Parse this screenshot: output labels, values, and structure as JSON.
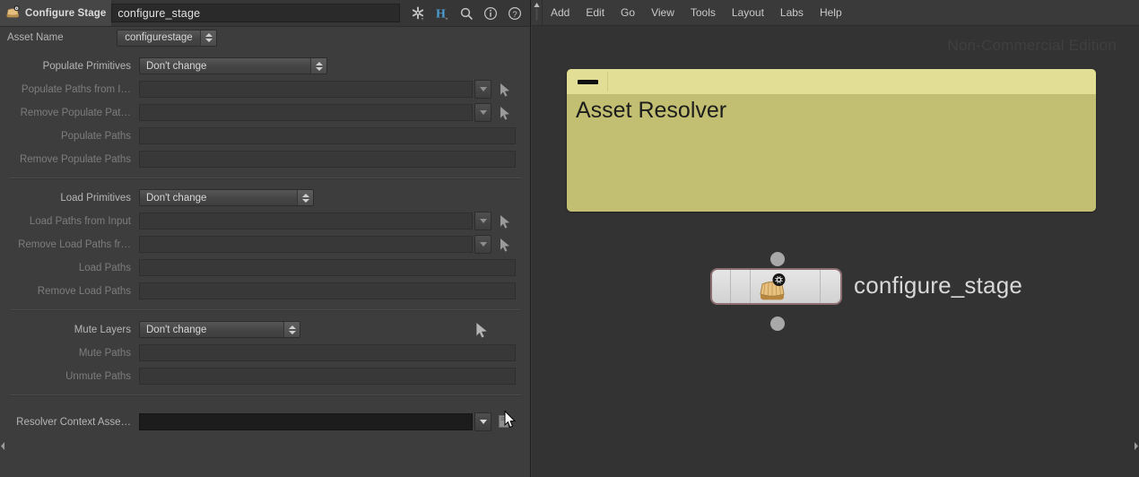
{
  "window": {
    "title": "Configure Stage"
  },
  "param_pane": {
    "tab": {
      "icon": "configure-stage-node-icon",
      "title": "Configure Stage"
    },
    "node_path": "configure_stage",
    "header_icons": [
      {
        "name": "gear-icon",
        "label": "Gear"
      },
      {
        "name": "houdini-h-icon",
        "label": "H"
      },
      {
        "name": "search-icon",
        "label": "Search"
      },
      {
        "name": "info-icon",
        "label": "Info"
      },
      {
        "name": "help-icon",
        "label": "Help"
      }
    ],
    "asset_name": {
      "label": "Asset Name",
      "value": "configurestage"
    },
    "groups": [
      {
        "rows": [
          {
            "label": "Populate Primitives",
            "type": "menu",
            "value": "Don't change",
            "disabled": false,
            "menu_width": "w210"
          },
          {
            "label": "Populate Paths from I…",
            "type": "field-drop-link",
            "value": "",
            "disabled": true
          },
          {
            "label": "Remove Populate Pat…",
            "type": "field-drop-link",
            "value": "",
            "disabled": true
          },
          {
            "label": "Populate Paths",
            "type": "field",
            "value": "",
            "disabled": true
          },
          {
            "label": "Remove Populate Paths",
            "type": "field",
            "value": "",
            "disabled": true
          }
        ]
      },
      {
        "rows": [
          {
            "label": "Load Primitives",
            "type": "menu",
            "value": "Don't change",
            "disabled": false,
            "menu_width": "w195"
          },
          {
            "label": "Load Paths from Input",
            "type": "field-drop-link",
            "value": "",
            "disabled": true
          },
          {
            "label": "Remove Load Paths fr…",
            "type": "field-drop-link",
            "value": "",
            "disabled": true
          },
          {
            "label": "Load Paths",
            "type": "field",
            "value": "",
            "disabled": true
          },
          {
            "label": "Remove Load Paths",
            "type": "field",
            "value": "",
            "disabled": true
          }
        ]
      },
      {
        "rows": [
          {
            "label": "Mute Layers",
            "type": "menu-link",
            "value": "Don't change",
            "disabled": false,
            "menu_width": "pmenu"
          },
          {
            "label": "Mute Paths",
            "type": "field",
            "value": "",
            "disabled": true
          },
          {
            "label": "Unmute Paths",
            "type": "field",
            "value": "",
            "disabled": true
          }
        ]
      },
      {
        "rows": [
          {
            "label": "Resolver Context Asse…",
            "type": "field-black-drop-file",
            "value": "",
            "disabled": false
          }
        ]
      }
    ]
  },
  "network_editor": {
    "menu": [
      "Add",
      "Edit",
      "Go",
      "View",
      "Tools",
      "Layout",
      "Labs",
      "Help"
    ],
    "watermark": "Non-Commercial Edition",
    "sticky_note": {
      "text": "Asset Resolver",
      "bg_color": "#c2bf72",
      "title_color": "#e2de95"
    },
    "node": {
      "label": "configure_stage",
      "icon": "configure-stage-node-icon",
      "selected_border_color": "#8d6f73",
      "body_color": "#dcdcdc"
    }
  },
  "colors": {
    "panel_bg": "#3d3d3d",
    "network_bg": "#333333",
    "field_bg": "#383838",
    "active_field_bg": "#1c1c1c",
    "text": "#c8c8c8",
    "disabled_text": "#7d7d7d",
    "houdini_blue": "#4a9fd4"
  }
}
